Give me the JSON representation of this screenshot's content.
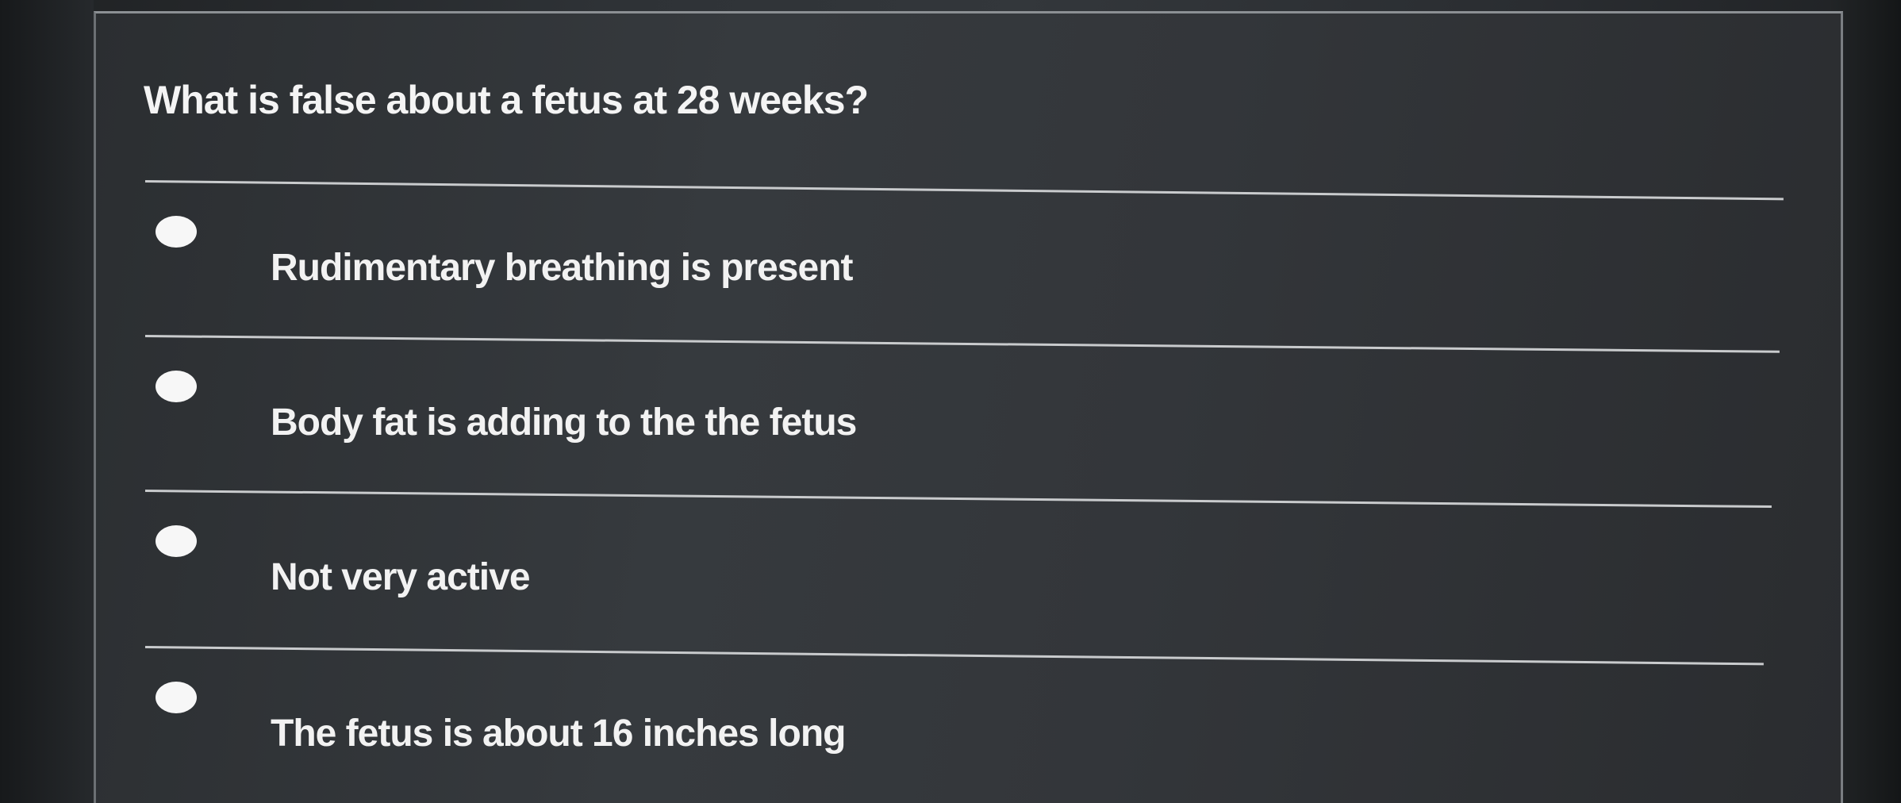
{
  "quiz": {
    "question": "What is false about a fetus at 28 weeks?",
    "options": [
      {
        "label": "Rudimentary breathing is present",
        "selected": false
      },
      {
        "label": "Body fat is adding to the the fetus",
        "selected": false
      },
      {
        "label": "Not very active",
        "selected": false
      },
      {
        "label": "The fetus is about 16 inches long",
        "selected": false
      }
    ]
  },
  "colors": {
    "background": "#2b2e31",
    "text": "#f4f4f4",
    "divider": "#c9cbcd",
    "radio": "#f7f7f7"
  }
}
